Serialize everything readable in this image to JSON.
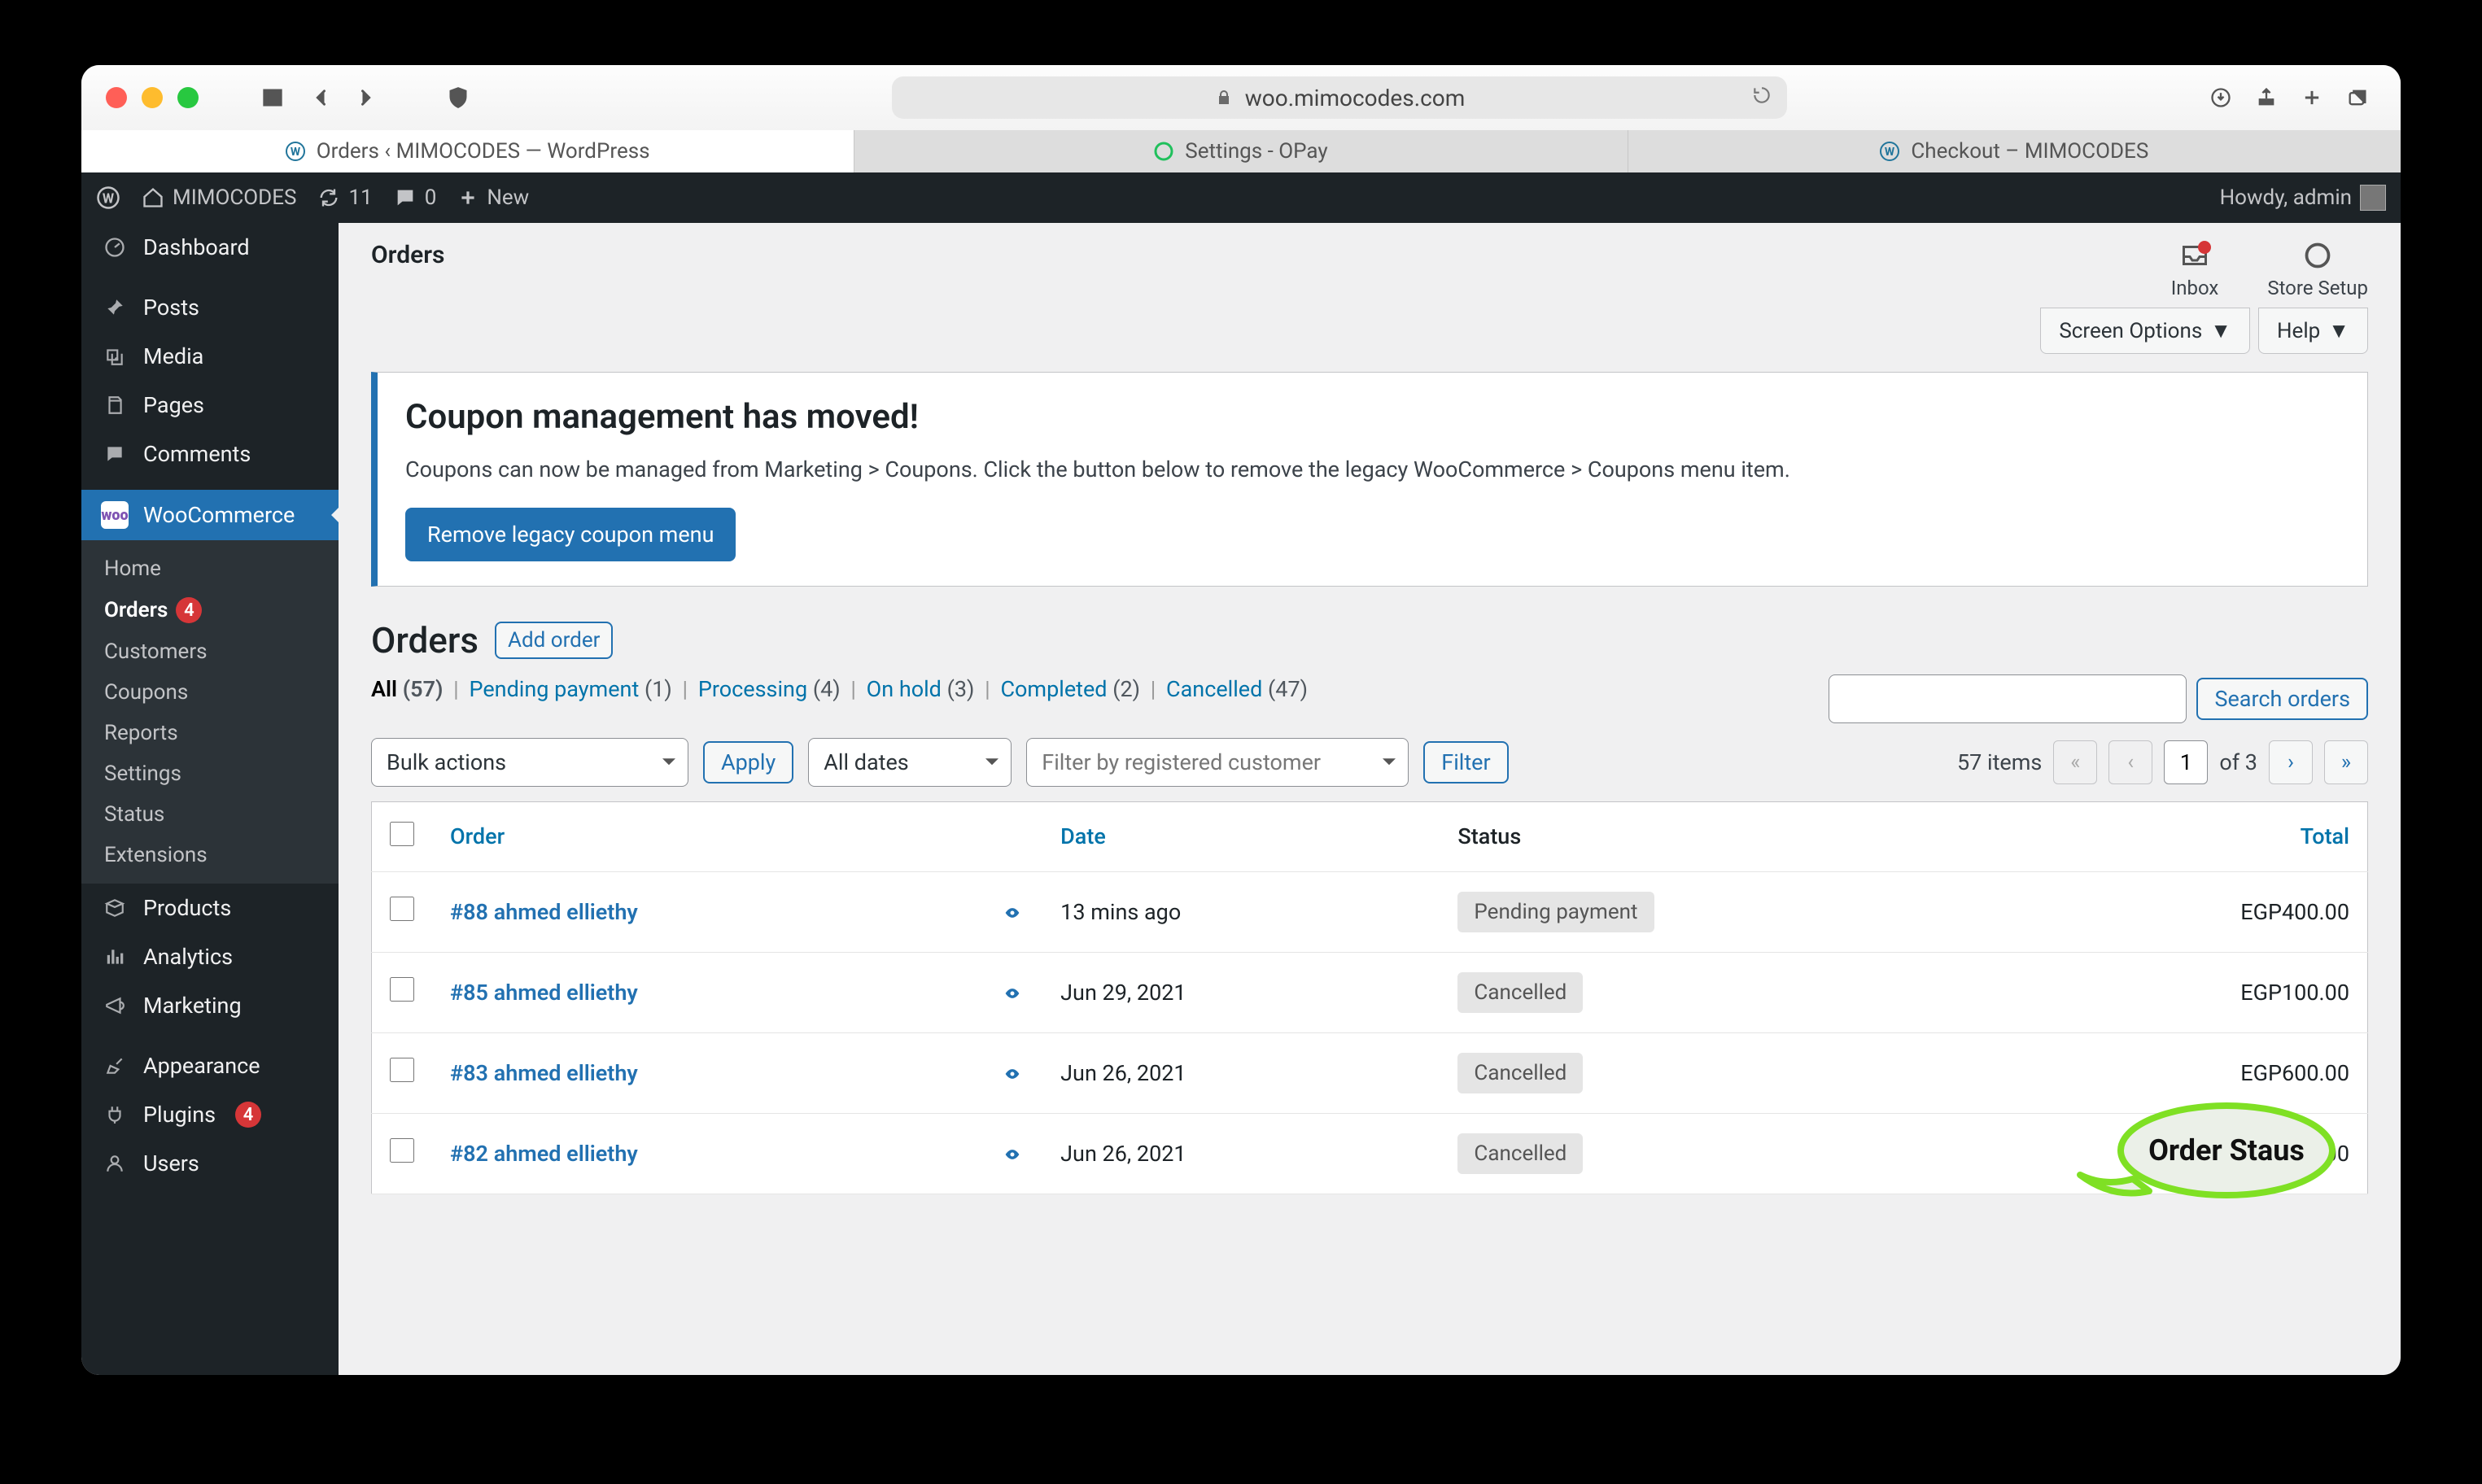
{
  "browser": {
    "url_host": "woo.mimocodes.com",
    "tabs": [
      {
        "label": "Orders ‹ MIMOCODES — WordPress",
        "icon": "wordpress-icon",
        "iconColor": "#21759b",
        "active": true
      },
      {
        "label": "Settings - OPay",
        "icon": "opay-icon",
        "iconColor": "#20c05c",
        "active": false
      },
      {
        "label": "Checkout – MIMOCODES",
        "icon": "wordpress-icon",
        "iconColor": "#21759b",
        "active": false
      }
    ]
  },
  "adminbar": {
    "site_name": "MIMOCODES",
    "updates": "11",
    "comments": "0",
    "new": "New",
    "howdy": "Howdy, admin"
  },
  "sidebar": {
    "items": [
      {
        "label": "Dashboard",
        "icon": "dashboard-icon"
      },
      {
        "label": "Posts",
        "icon": "pin-icon"
      },
      {
        "label": "Media",
        "icon": "media-icon"
      },
      {
        "label": "Pages",
        "icon": "pages-icon"
      },
      {
        "label": "Comments",
        "icon": "comment-icon"
      }
    ],
    "wc": {
      "label": "WooCommerce",
      "sub": [
        {
          "label": "Home"
        },
        {
          "label": "Orders",
          "current": true,
          "badge": "4"
        },
        {
          "label": "Customers"
        },
        {
          "label": "Coupons"
        },
        {
          "label": "Reports"
        },
        {
          "label": "Settings"
        },
        {
          "label": "Status"
        },
        {
          "label": "Extensions"
        }
      ]
    },
    "after": [
      {
        "label": "Products",
        "icon": "products-icon"
      },
      {
        "label": "Analytics",
        "icon": "analytics-icon"
      },
      {
        "label": "Marketing",
        "icon": "marketing-icon"
      }
    ],
    "after2": [
      {
        "label": "Appearance",
        "icon": "appearance-icon"
      },
      {
        "label": "Plugins",
        "icon": "plugins-icon",
        "badge": "4"
      },
      {
        "label": "Users",
        "icon": "users-icon"
      }
    ]
  },
  "header": {
    "title": "Orders",
    "inbox": "Inbox",
    "store_setup": "Store Setup",
    "screen_options": "Screen Options",
    "help": "Help"
  },
  "notice": {
    "title": "Coupon management has moved!",
    "body": "Coupons can now be managed from Marketing > Coupons. Click the button below to remove the legacy WooCommerce > Coupons menu item.",
    "button": "Remove legacy coupon menu"
  },
  "orders_heading": {
    "title": "Orders",
    "add": "Add order"
  },
  "statuses": [
    {
      "label": "All",
      "count": "(57)",
      "current": true
    },
    {
      "label": "Pending payment",
      "count": "(1)"
    },
    {
      "label": "Processing",
      "count": "(4)"
    },
    {
      "label": "On hold",
      "count": "(3)"
    },
    {
      "label": "Completed",
      "count": "(2)"
    },
    {
      "label": "Cancelled",
      "count": "(47)"
    }
  ],
  "search_button": "Search orders",
  "bulk": {
    "bulk_actions": "Bulk actions",
    "apply": "Apply",
    "all_dates": "All dates",
    "filter_cust_ph": "Filter by registered customer",
    "filter": "Filter"
  },
  "pagination": {
    "items_text": "57 items",
    "page": "1",
    "of": "of 3"
  },
  "columns": {
    "order": "Order",
    "date": "Date",
    "status": "Status",
    "total": "Total"
  },
  "rows": [
    {
      "order": "#88 ahmed elliethy",
      "date": "13 mins ago",
      "status": "Pending payment",
      "total": "EGP400.00"
    },
    {
      "order": "#85 ahmed elliethy",
      "date": "Jun 29, 2021",
      "status": "Cancelled",
      "total": "EGP100.00"
    },
    {
      "order": "#83 ahmed elliethy",
      "date": "Jun 26, 2021",
      "status": "Cancelled",
      "total": "EGP600.00"
    },
    {
      "order": "#82 ahmed elliethy",
      "date": "Jun 26, 2021",
      "status": "Cancelled",
      "total": "EGP400.00"
    }
  ],
  "callout": {
    "text": "Order Staus"
  }
}
